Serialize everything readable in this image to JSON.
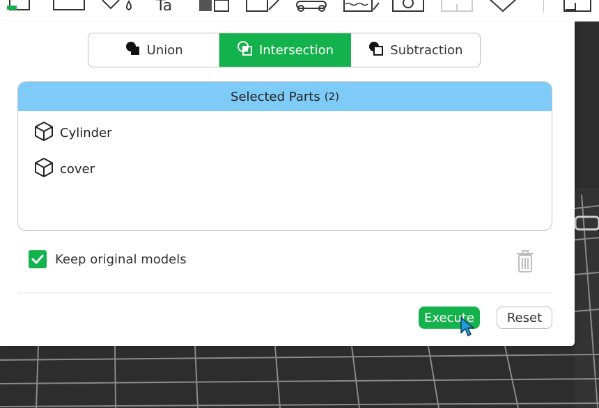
{
  "booleanModes": [
    {
      "label": "Union",
      "icon": "union-icon",
      "active": false
    },
    {
      "label": "Intersection",
      "icon": "intersection-icon",
      "active": true
    },
    {
      "label": "Subtraction",
      "icon": "subtraction-icon",
      "active": false
    }
  ],
  "parts": {
    "title": "Selected Parts",
    "count": "(2)",
    "items": [
      {
        "name": "Cylinder",
        "icon": "cube-icon"
      },
      {
        "name": "cover",
        "icon": "cube-icon"
      }
    ]
  },
  "options": {
    "keep_label": "Keep original models",
    "keep_checked": true
  },
  "actions": {
    "execute_label": "Execute",
    "reset_label": "Reset"
  },
  "colors": {
    "accent": "#14b24c",
    "header": "#7fcbf7",
    "viewport": "#2d2d2d"
  }
}
